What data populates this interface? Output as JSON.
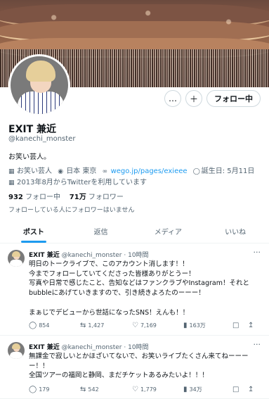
{
  "profile": {
    "display_name": "EXIT 兼近",
    "handle": "@kanechi_monster",
    "bio": "お笑い芸人。",
    "category": "お笑い芸人",
    "location": "日本 東京",
    "website": "wego.jp/pages/exieee",
    "birthday": "誕生日: 5月11日",
    "joined": "2013年8月からTwitterを利用しています",
    "following_count": "932",
    "following_label": "フォロー中",
    "followers_count": "71万",
    "followers_label": "フォロワー",
    "followers_note": "フォローしている人にフォロワーはいません"
  },
  "actions": {
    "more_label": "…",
    "notify_label": "＋",
    "follow_label": "フォロー中"
  },
  "tabs": [
    {
      "label": "ポスト"
    },
    {
      "label": "返信"
    },
    {
      "label": "メディア"
    },
    {
      "label": "いいね"
    }
  ],
  "tweets": [
    {
      "name": "EXIT 兼近",
      "handle": "@kanechi_monster",
      "time": "· 10時間",
      "lines": [
        "明日のトークライブで、このアカウント消します！！",
        "今までフォローしていてくださった皆様ありがとうー！",
        "写真や日常で感じたこと、告知などはファンクラブやInstagram！それと",
        "bubbleにあげていきますので、引き続きよろたのーーー！",
        "",
        "まぁじでデビューから世話になったSNS！えんも！！"
      ],
      "replies": "854",
      "retweets": "1,427",
      "likes": "7,169",
      "views": "163万"
    },
    {
      "name": "EXIT 兼近",
      "handle": "@kanechi_monster",
      "time": "· 10時間",
      "lines": [
        "無課金で寂しいとかほざいてないで、お笑いライブたくさん来てねーーー",
        "ー！！",
        "全国ツアーの福岡と静岡、まだチケットあるみたいよ！！！"
      ],
      "replies": "179",
      "retweets": "542",
      "likes": "1,779",
      "views": "34万"
    }
  ],
  "icons": {
    "category": "briefcase-icon",
    "location": "location-pin-icon",
    "website": "link-icon",
    "birthday": "balloon-icon",
    "joined": "calendar-icon"
  },
  "colors": {
    "accent": "#1d9bf0",
    "text": "#0f1419",
    "muted": "#536471"
  }
}
